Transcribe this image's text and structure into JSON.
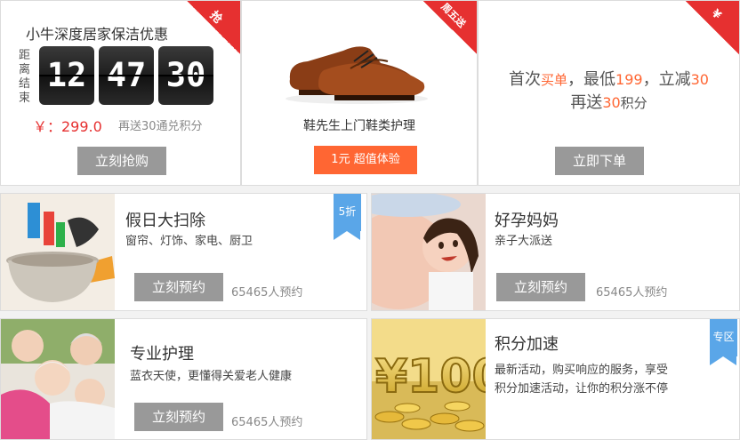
{
  "card1": {
    "ribbon": "抢",
    "title": "小牛深度居家保洁优惠",
    "countdown_label": "距离结束",
    "hours": "12",
    "minutes": "47",
    "seconds": "30",
    "price": "￥：299.0",
    "bonus": "再送30通兑积分",
    "button": "立刻抢购"
  },
  "card2": {
    "ribbon": "周五送",
    "title": "鞋先生上门鞋类护理",
    "button": "1元 超值体验"
  },
  "card3": {
    "ribbon": "¥",
    "line1_a": "首次",
    "line1_b": "买单",
    "line1_c": "，最低",
    "line1_d": "199",
    "line1_e": "，立减",
    "line1_f": "30",
    "line2_a": "再送",
    "line2_b": "30",
    "line2_c": "积分",
    "button": "立即下单"
  },
  "card4": {
    "title": "假日大扫除",
    "sub": "窗帘、灯饰、家电、厨卫",
    "tag": "5折",
    "button": "立刻预约",
    "count": "65465人预约"
  },
  "card5": {
    "title": "好孕妈妈",
    "sub": "亲子大派送",
    "button": "立刻预约",
    "count": "65465人预约"
  },
  "card6": {
    "title": "专业护理",
    "sub": "蓝衣天使，更懂得关爱老人健康",
    "button": "立刻预约",
    "count": "65465人预约"
  },
  "card7": {
    "title": "积分加速",
    "sub1": "最新活动，购买响应的服务，享受",
    "sub2": "积分加速活动，让你的积分涨不停",
    "tag": "专区"
  },
  "colors": {
    "accent": "#ff6633",
    "ribbon": "#e63030",
    "tag": "#5aa6e8",
    "button": "#999999"
  }
}
